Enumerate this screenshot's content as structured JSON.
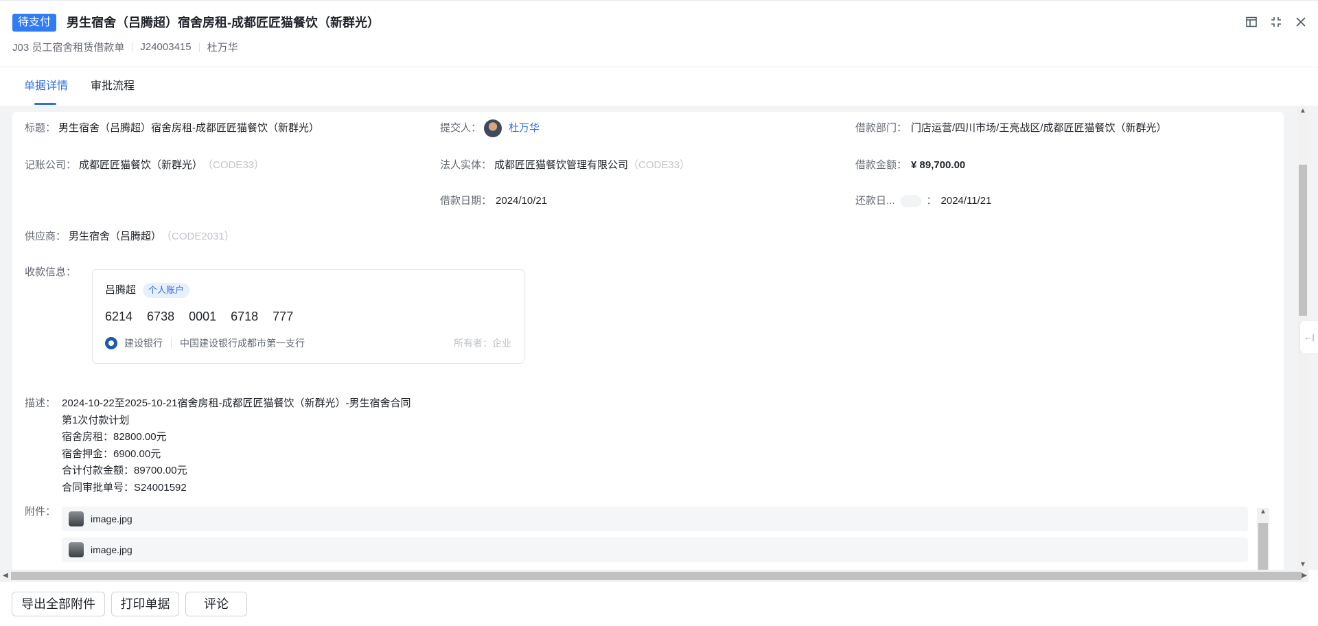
{
  "header": {
    "status": "待支付",
    "title": "男生宿舍（吕腾超）宿舍房租-成都匠匠猫餐饮（新群光）",
    "doc_type": "J03 员工宿舍租赁借款单",
    "doc_no": "J24003415",
    "submitter": "杜万华"
  },
  "tabs": [
    {
      "label": "单据详情",
      "active": true
    },
    {
      "label": "审批流程",
      "active": false
    }
  ],
  "fields": {
    "title_label": "标题：",
    "title_value": "男生宿舍（吕腾超）宿舍房租-成都匠匠猫餐饮（新群光）",
    "submitter_label": "提交人：",
    "submitter_value": "杜万华",
    "dept_label": "借款部门：",
    "dept_value": "门店运营/四川市场/王亮战区/成都匠匠猫餐饮（新群光）",
    "company_label": "记账公司：",
    "company_value": "成都匠匠猫餐饮（新群光）",
    "company_code": "（CODE33）",
    "entity_label": "法人实体：",
    "entity_value": "成都匠匠猫餐饮管理有限公司",
    "entity_code": "（CODE33）",
    "amount_label": "借款金额：",
    "amount_value": "¥ 89,700.00",
    "loan_date_label": "借款日期：",
    "loan_date_value": "2024/10/21",
    "repay_label": "还款日...",
    "repay_colon": "：",
    "repay_value": "2024/11/21",
    "supplier_label": "供应商：",
    "supplier_value": "男生宿舍（吕腾超）",
    "supplier_code": "（CODE2031）",
    "payment_label": "收款信息："
  },
  "bank_card": {
    "payee": "吕腾超",
    "account_type": "个人账户",
    "account_number": "6214 6738 0001 6718 777",
    "bank": "建设银行",
    "branch": "中国建设银行成都市第一支行",
    "owner": "所有者：企业"
  },
  "description": {
    "label": "描述：",
    "lines": [
      "2024-10-22至2025-10-21宿舍房租-成都匠匠猫餐饮（新群光）-男生宿舍合同",
      "第1次付款计划",
      "宿舍房租：82800.00元",
      "宿舍押金：6900.00元",
      "合计付款金额：89700.00元",
      "合同审批单号：S24001592"
    ]
  },
  "attachments": {
    "label": "附件：",
    "files": [
      "image.jpg",
      "image.jpg"
    ]
  },
  "footer": {
    "export": "导出全部附件",
    "print": "打印单据",
    "comment": "评论"
  },
  "icons": {
    "side_tab": "←|"
  },
  "colors": {
    "accent": "#2f6fe0",
    "status_bg": "#2f7cf6"
  }
}
